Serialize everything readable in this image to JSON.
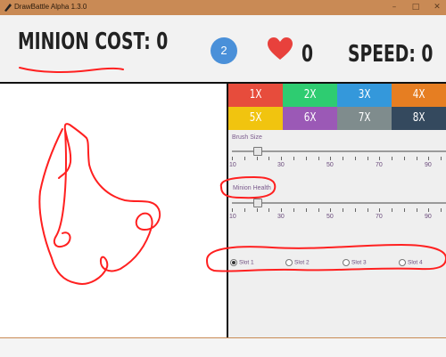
{
  "window": {
    "title": "DrawBattle Alpha 1.3.0",
    "minimize_glyph": "–",
    "maximize_glyph": "□",
    "close_glyph": "✕"
  },
  "header": {
    "minion_cost": "MINION COST: 0",
    "coins": "2",
    "lives": "0",
    "speed": "SPEED: 0"
  },
  "speed_buttons": [
    {
      "label": "1X",
      "color": "#e74c3c"
    },
    {
      "label": "2X",
      "color": "#2ecc71"
    },
    {
      "label": "3X",
      "color": "#3498db"
    },
    {
      "label": "4X",
      "color": "#e67e22"
    },
    {
      "label": "5X",
      "color": "#f1c40f"
    },
    {
      "label": "6X",
      "color": "#9b59b6"
    },
    {
      "label": "7X",
      "color": "#7f8c8d"
    },
    {
      "label": "8X",
      "color": "#34495e"
    }
  ],
  "brush_size": {
    "label": "Brush Size",
    "value": 20,
    "ticks": [
      "10",
      "30",
      "50",
      "70",
      "90"
    ]
  },
  "minion_health": {
    "label": "Minion Health",
    "value": 20,
    "ticks": [
      "10",
      "30",
      "50",
      "70",
      "90"
    ]
  },
  "slots": [
    {
      "label": "Slot 1",
      "selected": true
    },
    {
      "label": "Slot 2",
      "selected": false
    },
    {
      "label": "Slot 3",
      "selected": false
    },
    {
      "label": "Slot 4",
      "selected": false
    }
  ],
  "icons": {
    "app": "pencil-icon",
    "heart": "heart-icon",
    "coin": "coin-icon"
  },
  "colors": {
    "ink": "#ff2020",
    "titlebar": "#c98a55",
    "coin": "#4a90d9",
    "heart": "#e8413c"
  }
}
